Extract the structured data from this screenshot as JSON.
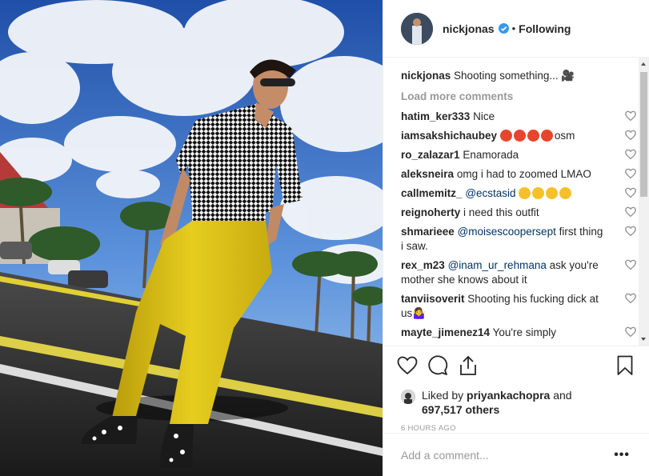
{
  "post": {
    "username": "nickjonas",
    "follow_status": "Following",
    "dot": "•",
    "caption_user": "nickjonas",
    "caption_text": "Shooting something... 🎥"
  },
  "comments_section": {
    "load_more": "Load more comments",
    "items": [
      {
        "user": "hatim_ker333",
        "text": "Nice"
      },
      {
        "user": "iamsakshichaubey",
        "emoji_count": 4,
        "emoji_color": "#e8452c",
        "text": "osm"
      },
      {
        "user": "ro_zalazar1",
        "text": "Enamorada"
      },
      {
        "user": "aleksneira",
        "text": "omg i had to zoomed LMAO"
      },
      {
        "user": "callmemitz_",
        "mention": "@ecstasid",
        "emoji_count": 4,
        "emoji_color": "#f5c02a"
      },
      {
        "user": "reignoherty",
        "text": "i need this outfit"
      },
      {
        "user": "shmarieee",
        "mention": "@moisescoopersept",
        "text": "first thing i saw."
      },
      {
        "user": "rex_m23",
        "mention": "@inam_ur_rehmana",
        "text": "ask you're mother she knows about it"
      },
      {
        "user": "tanviisoverit",
        "text": "Shooting his fucking dick at us🤷‍♀️"
      },
      {
        "user": "mayte_jimenez14",
        "text": "You're simply"
      }
    ]
  },
  "likes": {
    "prefix": "Liked by",
    "user": "priyankachopra",
    "and": "and",
    "others": "697,517 others"
  },
  "timestamp": "6 HOURS AGO",
  "composer": {
    "placeholder": "Add a comment...",
    "more": "•••"
  },
  "colors": {
    "text": "#262626",
    "muted": "#999999",
    "link": "#003569",
    "verified": "#3897f0",
    "border": "#efefef"
  },
  "icons": [
    "heart-icon",
    "comment-icon",
    "share-icon",
    "bookmark-icon",
    "verified-icon"
  ]
}
